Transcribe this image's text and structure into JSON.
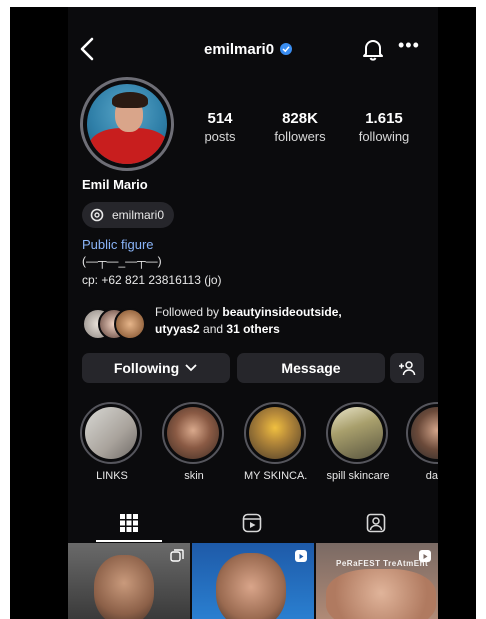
{
  "profile": {
    "username": "emilmari0",
    "display_name": "Emil Mario",
    "threads_handle": "emilmari0",
    "category": "Public figure",
    "bio_line1": "(—┬—_—┬—)",
    "bio_line2": "cp: +62 821 23816113 (jo)",
    "followed_by_prefix": "Followed by ",
    "followed_by_names": "beautyinsideoutside,",
    "followed_by_name2": "utyyas2",
    "followed_by_and": " and ",
    "followed_by_others": "31 others"
  },
  "stats": [
    {
      "value": "514",
      "label": "posts"
    },
    {
      "value": "828K",
      "label": "followers"
    },
    {
      "value": "1.615",
      "label": "following"
    }
  ],
  "actions": {
    "following_label": "Following",
    "message_label": "Message",
    "add_icon": "add-person-icon"
  },
  "highlights": [
    {
      "label": "LINKS"
    },
    {
      "label": "skin"
    },
    {
      "label": "MY SKINCA..."
    },
    {
      "label": "spill skincare"
    },
    {
      "label": "dang"
    }
  ],
  "tabs": [
    {
      "icon": "grid-icon"
    },
    {
      "icon": "reels-icon"
    },
    {
      "icon": "tagged-icon"
    }
  ],
  "grid": {
    "cell3_caption": "PeRaFEST TreAtmEnt"
  },
  "colors": {
    "background": "#0b0b0d",
    "verified": "#3a8df0",
    "link": "#8ab4f8",
    "button": "#26262b"
  }
}
